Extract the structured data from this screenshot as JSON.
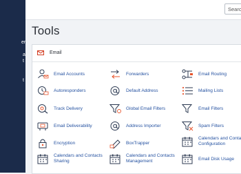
{
  "search": {
    "placeholder": "Searc"
  },
  "sidebar": {
    "fragments": [
      "er",
      "a",
      "t",
      "t"
    ]
  },
  "page": {
    "title": "Tools"
  },
  "panel": {
    "title": "Email"
  },
  "tools": [
    {
      "label": "Email Accounts",
      "icon": "email-accounts-icon"
    },
    {
      "label": "Forwarders",
      "icon": "forwarders-icon"
    },
    {
      "label": "Email Routing",
      "icon": "email-routing-icon"
    },
    {
      "label": "Autoresponders",
      "icon": "autoresponders-icon"
    },
    {
      "label": "Default Address",
      "icon": "default-address-icon"
    },
    {
      "label": "Mailing Lists",
      "icon": "mailing-lists-icon"
    },
    {
      "label": "Track Delivery",
      "icon": "track-delivery-icon"
    },
    {
      "label": "Global Email Filters",
      "icon": "global-email-filters-icon"
    },
    {
      "label": "Email Filters",
      "icon": "email-filters-icon"
    },
    {
      "label": "Email Deliverability",
      "icon": "email-deliverability-icon"
    },
    {
      "label": "Address Importer",
      "icon": "address-importer-icon"
    },
    {
      "label": "Spam Filters",
      "icon": "spam-filters-icon"
    },
    {
      "label": "Encryption",
      "icon": "encryption-icon"
    },
    {
      "label": "BoxTrapper",
      "icon": "boxtrapper-icon"
    },
    {
      "label": "Calendars and Contacts Configuration",
      "line1": "Calendars and Contacts",
      "line2": "Configuration",
      "icon": "calendars-contacts-configuration-icon"
    },
    {
      "label": "Calendars and Contacts Sharing",
      "line1": "Calendars and Contacts",
      "line2": "Sharing",
      "icon": "calendars-contacts-sharing-icon"
    },
    {
      "label": "Calendars and Contacts Management",
      "line1": "Calendars and Contacts",
      "line2": "Management",
      "icon": "calendars-contacts-management-icon"
    },
    {
      "label": "Email Disk Usage",
      "icon": "email-disk-usage-icon"
    }
  ],
  "colors": {
    "sidebar": "#1b2b4a",
    "link": "#2451a0",
    "icon_accent": "#e8542b",
    "icon_stroke": "#2c3a52",
    "background": "#f1f3f6"
  }
}
